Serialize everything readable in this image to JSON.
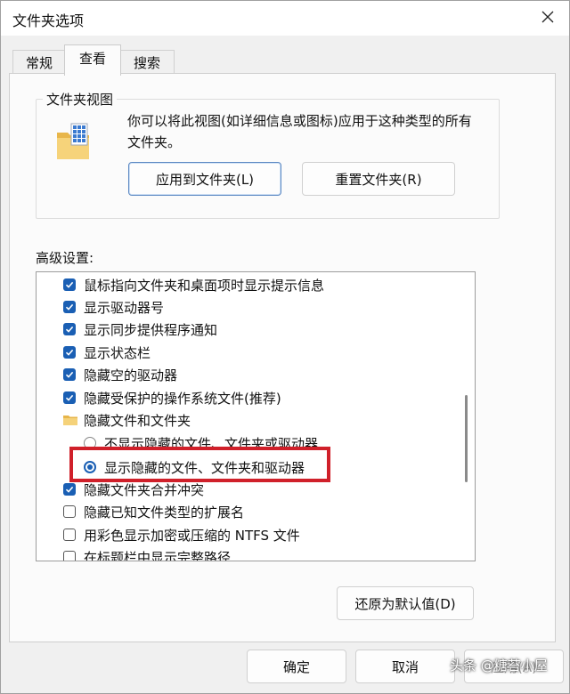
{
  "window": {
    "title": "文件夹选项"
  },
  "tabs": [
    {
      "label": "常规"
    },
    {
      "label": "查看"
    },
    {
      "label": "搜索"
    }
  ],
  "folder_view": {
    "legend": "文件夹视图",
    "description": "你可以将此视图(如详细信息或图标)应用于这种类型的所有文件夹。",
    "apply_button": "应用到文件夹(L)",
    "reset_button": "重置文件夹(R)"
  },
  "advanced": {
    "label": "高级设置:",
    "items": [
      {
        "type": "checkbox",
        "checked": true,
        "label": "鼠标指向文件夹和桌面项时显示提示信息"
      },
      {
        "type": "checkbox",
        "checked": true,
        "label": "显示驱动器号"
      },
      {
        "type": "checkbox",
        "checked": true,
        "label": "显示同步提供程序通知"
      },
      {
        "type": "checkbox",
        "checked": true,
        "label": "显示状态栏"
      },
      {
        "type": "checkbox",
        "checked": true,
        "label": "隐藏空的驱动器"
      },
      {
        "type": "checkbox",
        "checked": true,
        "label": "隐藏受保护的操作系统文件(推荐)"
      },
      {
        "type": "folder",
        "label": "隐藏文件和文件夹"
      },
      {
        "type": "radio",
        "selected": false,
        "label": "不显示隐藏的文件、文件夹或驱动器"
      },
      {
        "type": "radio",
        "selected": true,
        "label": "显示隐藏的文件、文件夹和驱动器"
      },
      {
        "type": "checkbox",
        "checked": true,
        "label": "隐藏文件夹合并冲突"
      },
      {
        "type": "checkbox",
        "checked": false,
        "label": "隐藏已知文件类型的扩展名"
      },
      {
        "type": "checkbox",
        "checked": false,
        "label": "用彩色显示加密或压缩的 NTFS 文件"
      },
      {
        "type": "checkbox",
        "checked": false,
        "label": "在标题栏中显示完整路径"
      }
    ],
    "restore_button": "还原为默认值(D)"
  },
  "footer": {
    "ok": "确定",
    "cancel": "取消",
    "apply": "应用(A)"
  },
  "watermark": "头条 @糖苔小屋",
  "colors": {
    "accent": "#1a5fb4",
    "highlight": "#d0202a"
  }
}
